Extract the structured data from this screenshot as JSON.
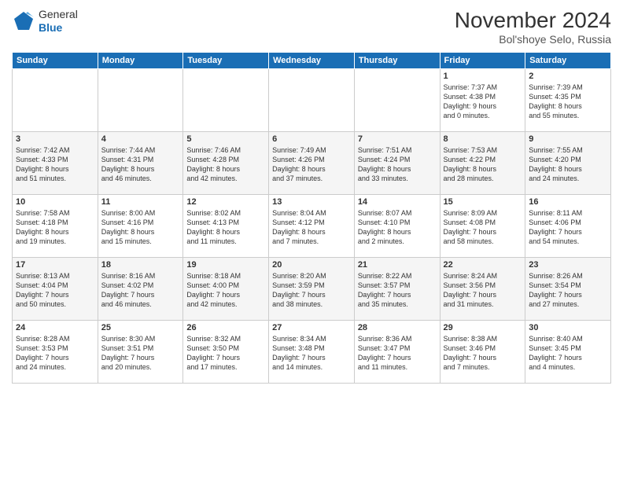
{
  "header": {
    "logo_general": "General",
    "logo_blue": "Blue",
    "title": "November 2024",
    "location": "Bol'shoye Selo, Russia"
  },
  "weekdays": [
    "Sunday",
    "Monday",
    "Tuesday",
    "Wednesday",
    "Thursday",
    "Friday",
    "Saturday"
  ],
  "weeks": [
    [
      {
        "day": "",
        "info": ""
      },
      {
        "day": "",
        "info": ""
      },
      {
        "day": "",
        "info": ""
      },
      {
        "day": "",
        "info": ""
      },
      {
        "day": "",
        "info": ""
      },
      {
        "day": "1",
        "info": "Sunrise: 7:37 AM\nSunset: 4:38 PM\nDaylight: 9 hours\nand 0 minutes."
      },
      {
        "day": "2",
        "info": "Sunrise: 7:39 AM\nSunset: 4:35 PM\nDaylight: 8 hours\nand 55 minutes."
      }
    ],
    [
      {
        "day": "3",
        "info": "Sunrise: 7:42 AM\nSunset: 4:33 PM\nDaylight: 8 hours\nand 51 minutes."
      },
      {
        "day": "4",
        "info": "Sunrise: 7:44 AM\nSunset: 4:31 PM\nDaylight: 8 hours\nand 46 minutes."
      },
      {
        "day": "5",
        "info": "Sunrise: 7:46 AM\nSunset: 4:28 PM\nDaylight: 8 hours\nand 42 minutes."
      },
      {
        "day": "6",
        "info": "Sunrise: 7:49 AM\nSunset: 4:26 PM\nDaylight: 8 hours\nand 37 minutes."
      },
      {
        "day": "7",
        "info": "Sunrise: 7:51 AM\nSunset: 4:24 PM\nDaylight: 8 hours\nand 33 minutes."
      },
      {
        "day": "8",
        "info": "Sunrise: 7:53 AM\nSunset: 4:22 PM\nDaylight: 8 hours\nand 28 minutes."
      },
      {
        "day": "9",
        "info": "Sunrise: 7:55 AM\nSunset: 4:20 PM\nDaylight: 8 hours\nand 24 minutes."
      }
    ],
    [
      {
        "day": "10",
        "info": "Sunrise: 7:58 AM\nSunset: 4:18 PM\nDaylight: 8 hours\nand 19 minutes."
      },
      {
        "day": "11",
        "info": "Sunrise: 8:00 AM\nSunset: 4:16 PM\nDaylight: 8 hours\nand 15 minutes."
      },
      {
        "day": "12",
        "info": "Sunrise: 8:02 AM\nSunset: 4:13 PM\nDaylight: 8 hours\nand 11 minutes."
      },
      {
        "day": "13",
        "info": "Sunrise: 8:04 AM\nSunset: 4:12 PM\nDaylight: 8 hours\nand 7 minutes."
      },
      {
        "day": "14",
        "info": "Sunrise: 8:07 AM\nSunset: 4:10 PM\nDaylight: 8 hours\nand 2 minutes."
      },
      {
        "day": "15",
        "info": "Sunrise: 8:09 AM\nSunset: 4:08 PM\nDaylight: 7 hours\nand 58 minutes."
      },
      {
        "day": "16",
        "info": "Sunrise: 8:11 AM\nSunset: 4:06 PM\nDaylight: 7 hours\nand 54 minutes."
      }
    ],
    [
      {
        "day": "17",
        "info": "Sunrise: 8:13 AM\nSunset: 4:04 PM\nDaylight: 7 hours\nand 50 minutes."
      },
      {
        "day": "18",
        "info": "Sunrise: 8:16 AM\nSunset: 4:02 PM\nDaylight: 7 hours\nand 46 minutes."
      },
      {
        "day": "19",
        "info": "Sunrise: 8:18 AM\nSunset: 4:00 PM\nDaylight: 7 hours\nand 42 minutes."
      },
      {
        "day": "20",
        "info": "Sunrise: 8:20 AM\nSunset: 3:59 PM\nDaylight: 7 hours\nand 38 minutes."
      },
      {
        "day": "21",
        "info": "Sunrise: 8:22 AM\nSunset: 3:57 PM\nDaylight: 7 hours\nand 35 minutes."
      },
      {
        "day": "22",
        "info": "Sunrise: 8:24 AM\nSunset: 3:56 PM\nDaylight: 7 hours\nand 31 minutes."
      },
      {
        "day": "23",
        "info": "Sunrise: 8:26 AM\nSunset: 3:54 PM\nDaylight: 7 hours\nand 27 minutes."
      }
    ],
    [
      {
        "day": "24",
        "info": "Sunrise: 8:28 AM\nSunset: 3:53 PM\nDaylight: 7 hours\nand 24 minutes."
      },
      {
        "day": "25",
        "info": "Sunrise: 8:30 AM\nSunset: 3:51 PM\nDaylight: 7 hours\nand 20 minutes."
      },
      {
        "day": "26",
        "info": "Sunrise: 8:32 AM\nSunset: 3:50 PM\nDaylight: 7 hours\nand 17 minutes."
      },
      {
        "day": "27",
        "info": "Sunrise: 8:34 AM\nSunset: 3:48 PM\nDaylight: 7 hours\nand 14 minutes."
      },
      {
        "day": "28",
        "info": "Sunrise: 8:36 AM\nSunset: 3:47 PM\nDaylight: 7 hours\nand 11 minutes."
      },
      {
        "day": "29",
        "info": "Sunrise: 8:38 AM\nSunset: 3:46 PM\nDaylight: 7 hours\nand 7 minutes."
      },
      {
        "day": "30",
        "info": "Sunrise: 8:40 AM\nSunset: 3:45 PM\nDaylight: 7 hours\nand 4 minutes."
      }
    ]
  ]
}
